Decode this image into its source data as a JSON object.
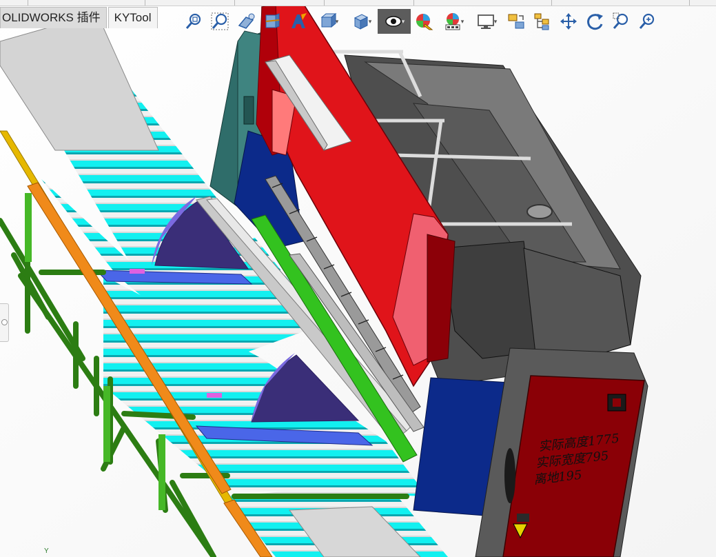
{
  "tabs": [
    {
      "label": "OLIDWORKS 插件"
    },
    {
      "label": "KYTool"
    }
  ],
  "hud_toolbar": [
    {
      "icon": "zoom-to-fit-icon"
    },
    {
      "icon": "zoom-to-area-icon"
    },
    {
      "icon": "previous-view-icon"
    },
    {
      "icon": "section-view-icon"
    },
    {
      "icon": "dynamic-annotation-icon"
    },
    {
      "icon": "view-orientation-icon"
    },
    {
      "icon": "display-style-icon"
    },
    {
      "icon": "hide-show-items-icon"
    },
    {
      "icon": "edit-appearance-icon"
    },
    {
      "icon": "apply-scene-icon"
    },
    {
      "icon": "view-settings-icon"
    },
    {
      "icon": "rotate-view-icon"
    },
    {
      "icon": "tree-structure-icon"
    },
    {
      "icon": "pan-icon"
    },
    {
      "icon": "rotate-icon"
    },
    {
      "icon": "zoom-in-out-icon"
    },
    {
      "icon": "zoom-icon"
    }
  ],
  "annotation": {
    "lines": [
      "实际高度1775",
      "实际宽度795",
      "离地195"
    ]
  },
  "triad": {
    "y_label": "Y"
  },
  "colors": {
    "roller": "#12f0f0",
    "roller_dark": "#0aa7b0",
    "frame_green": "#3a9a1c",
    "rail_orange": "#f08a1a",
    "rail_yellow": "#e6b800",
    "press_red": "#e0141a",
    "press_dark_red": "#8c0008",
    "cabinet_teal": "#2f6d6a",
    "navy": "#0c2a8a",
    "gray_body": "#5c5c5c",
    "light_gray": "#cfcfcf",
    "bright_green": "#33c21f",
    "purple": "#6e5fd6",
    "control_red": "#8a0006"
  }
}
